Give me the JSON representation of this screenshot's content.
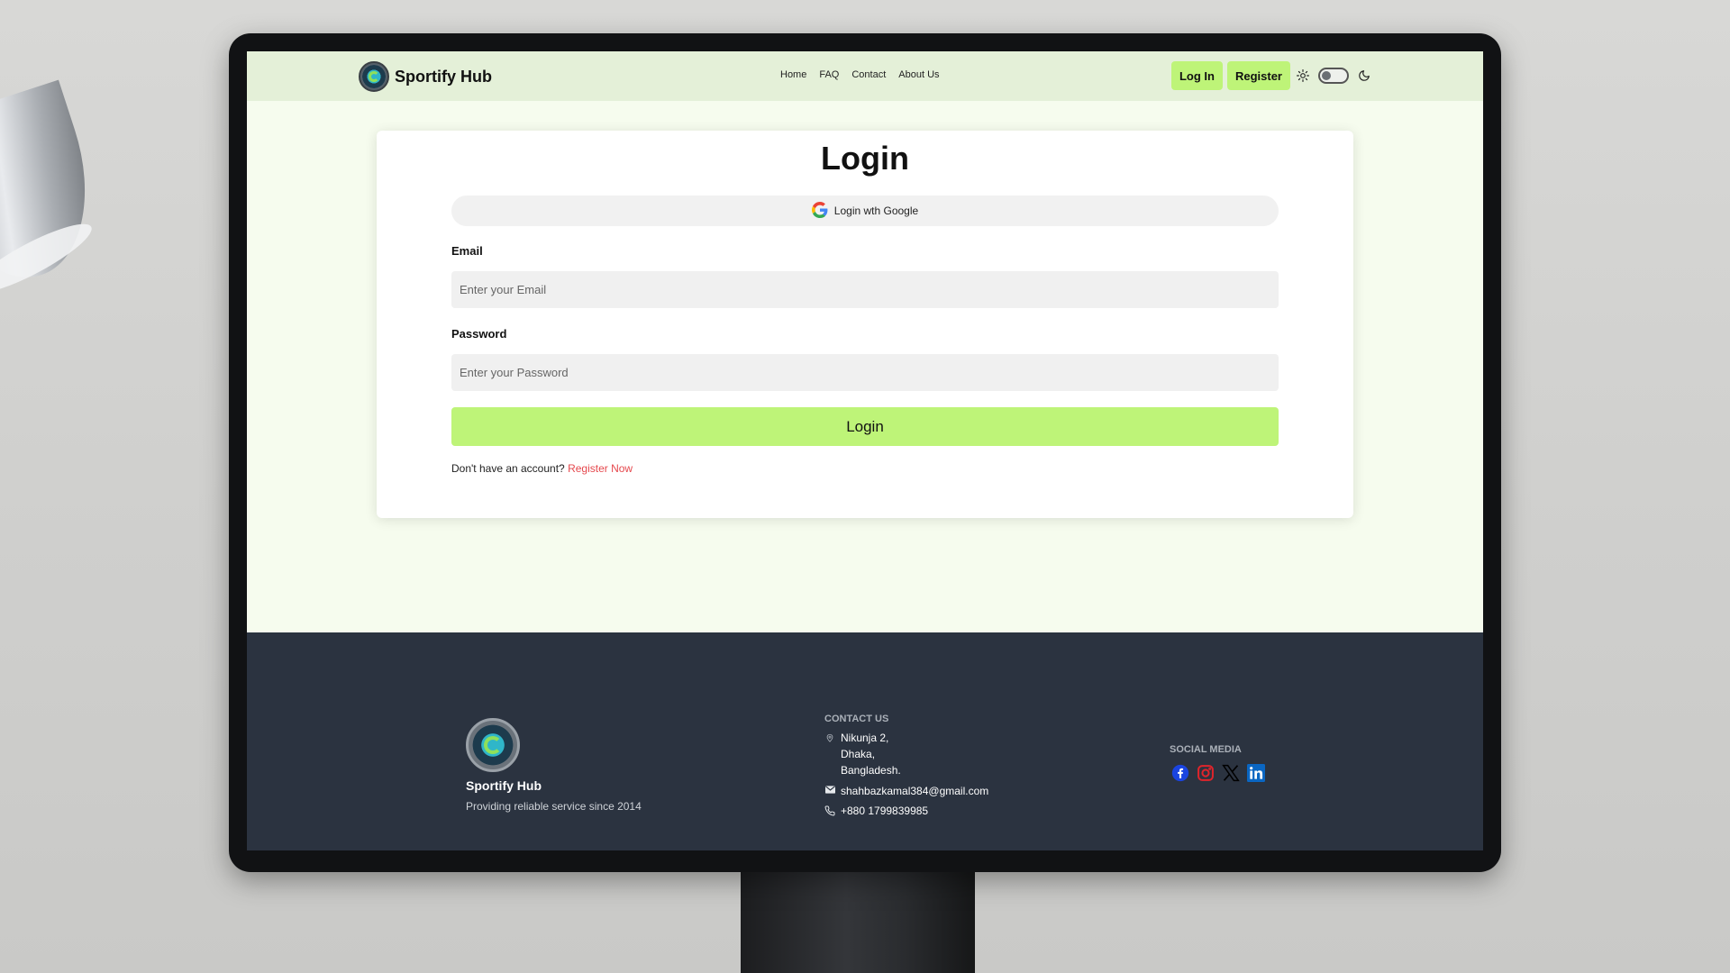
{
  "brand": {
    "name": "Sportify Hub"
  },
  "nav": {
    "links": [
      "Home",
      "FAQ",
      "Contact",
      "About Us"
    ],
    "login_label": "Log In",
    "register_label": "Register",
    "theme_icons": [
      "sun-icon",
      "moon-icon"
    ],
    "theme_toggle": "light"
  },
  "login": {
    "title": "Login",
    "google_label": "Login wth Google",
    "email_label": "Email",
    "email_placeholder": "Enter your Email",
    "email_value": "",
    "password_label": "Password",
    "password_placeholder": "Enter your Password",
    "password_value": "",
    "submit_label": "Login",
    "register_prompt": "Don't have an account?",
    "register_link": "Register Now"
  },
  "footer": {
    "brand_name": "Sportify Hub",
    "tagline": "Providing reliable service since 2014",
    "contact_heading": "CONTACT US",
    "address_lines": [
      "Nikunja 2,",
      "Dhaka,",
      "Bangladesh."
    ],
    "email": "shahbazkamal384@gmail.com",
    "phone": "+880 1799839985",
    "social_heading": "SOCIAL MEDIA",
    "social_icons": [
      "facebook-icon",
      "instagram-icon",
      "x-icon",
      "linkedin-icon"
    ]
  },
  "colors": {
    "accent": "#bef478",
    "navbar_bg": "#e4f0d8",
    "page_bg": "#f6fcee",
    "footer_bg": "#2b3340",
    "link_red": "#e5484d",
    "facebook": "#1a44e0",
    "instagram": "#e0242b",
    "linkedin": "#0a66c2"
  }
}
